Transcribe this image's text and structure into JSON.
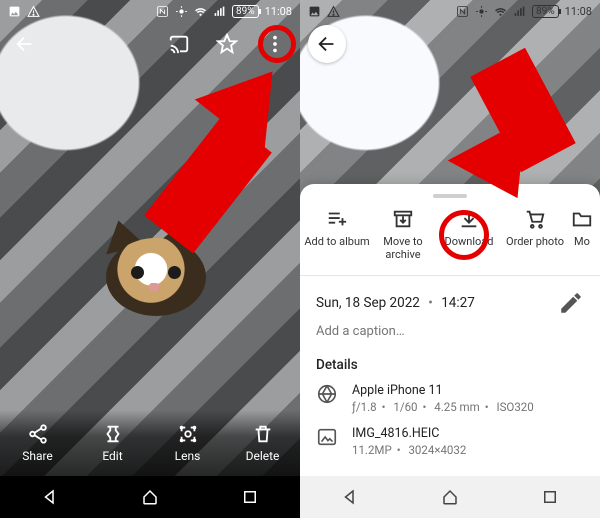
{
  "status": {
    "battery": "89%",
    "time": "11:08"
  },
  "left": {
    "actions": {
      "share": "Share",
      "edit": "Edit",
      "lens": "Lens",
      "delete": "Delete"
    }
  },
  "right": {
    "sheet": {
      "add_album": "Add to album",
      "archive_l1": "Move to",
      "archive_l2": "archive",
      "download": "Download",
      "order": "Order photo",
      "more_cut": "Mo",
      "meta": {
        "date": "Sun, 18 Sep 2022",
        "time": "14:27",
        "caption_placeholder": "Add a caption…"
      },
      "details": {
        "heading": "Details",
        "cam_name": "Apple iPhone 11",
        "cam_f": "ƒ/1.8",
        "cam_shutter": "1/60",
        "cam_focal": "4.25 mm",
        "cam_iso": "ISO320",
        "file_name": "IMG_4816.HEIC",
        "file_mp": "11.2MP",
        "file_dim": "3024×4032"
      }
    }
  }
}
